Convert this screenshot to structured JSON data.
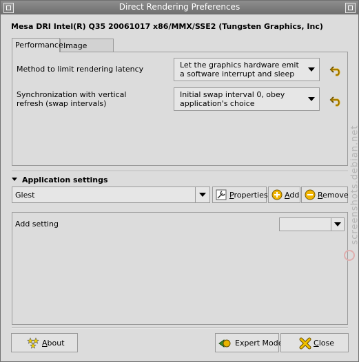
{
  "window": {
    "title": "Direct Rendering Preferences"
  },
  "driver_heading": "Mesa DRI Intel(R) Q35 20061017 x86/MMX/SSE2 (Tungsten Graphics, Inc)",
  "tabs": [
    {
      "label": "Performance",
      "active": true
    },
    {
      "label": "Image Quality",
      "active": false
    }
  ],
  "performance": {
    "options": [
      {
        "label": "Method to limit rendering latency",
        "value": "Let the graphics hardware emit a software interrupt and sleep"
      },
      {
        "label": "Synchronization with vertical refresh (swap intervals)",
        "value": "Initial swap interval 0, obey application's choice"
      }
    ]
  },
  "app_settings": {
    "section_label": "Application settings",
    "selected_app": "Glest",
    "properties_label": "Properties",
    "add_label": "Add",
    "remove_label": "Remove",
    "add_setting_label": "Add setting",
    "add_setting_value": ""
  },
  "footer": {
    "about_label": "About",
    "expert_mode_label": "Expert Mode",
    "close_label": "Close"
  },
  "watermark": {
    "text": "screenshots.debian.net"
  },
  "colors": {
    "titlebar": "#7d7d7d",
    "window_bg": "#dcdcdc",
    "accent_yellow": "#f0b400",
    "close_icon": "#e8a800"
  }
}
